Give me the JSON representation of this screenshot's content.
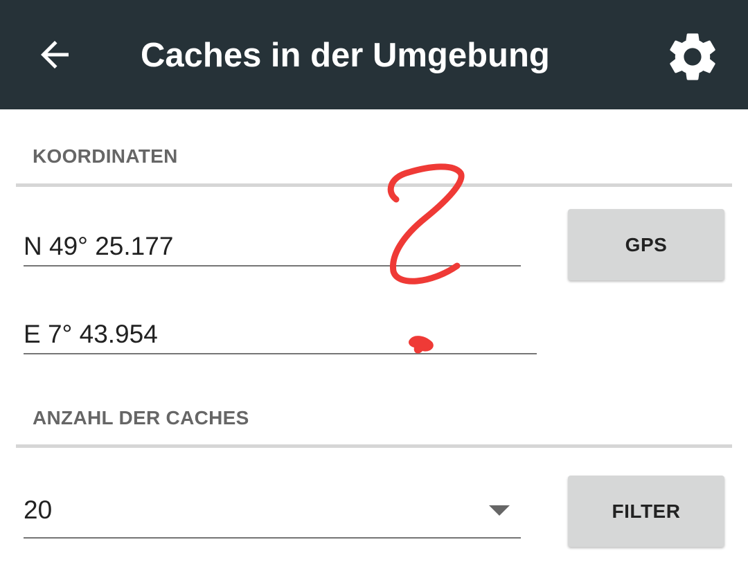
{
  "toolbar": {
    "title": "Caches in der Umgebung",
    "back_icon": "arrow-back-icon",
    "settings_icon": "gear-icon",
    "background_color": "#263238"
  },
  "coordinates_section": {
    "header": "KOORDINATEN",
    "latitude": "N 49° 25.177",
    "longitude": "E 7° 43.954",
    "gps_button_label": "GPS"
  },
  "count_section": {
    "header": "ANZAHL DER CACHES",
    "selected_count": "20",
    "filter_button_label": "FILTER"
  },
  "annotation": {
    "color": "#ef3a36"
  }
}
